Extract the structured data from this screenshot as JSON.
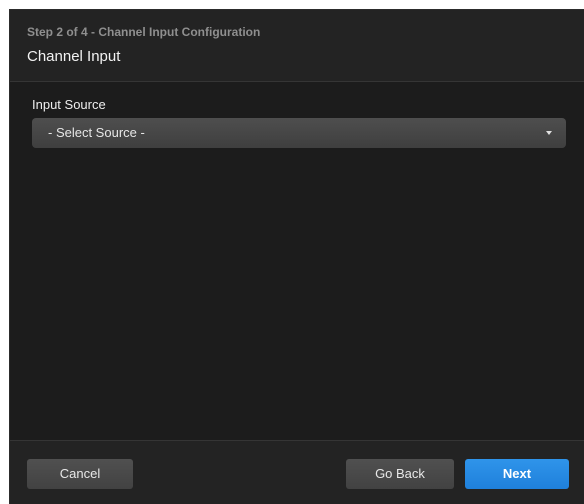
{
  "dialog": {
    "step_label": "Step 2 of 4 - Channel Input Configuration",
    "title": "Channel Input"
  },
  "form": {
    "input_source": {
      "label": "Input Source",
      "selected_value": "- Select Source -"
    }
  },
  "footer": {
    "cancel_label": "Cancel",
    "back_label": "Go Back",
    "next_label": "Next"
  },
  "colors": {
    "dialog_background": "#1c1c1c",
    "primary_button": "#1f80db",
    "secondary_button": "#484848",
    "step_text": "#8f8f8f"
  },
  "icons": {
    "select_caret": "caret-down-icon"
  }
}
